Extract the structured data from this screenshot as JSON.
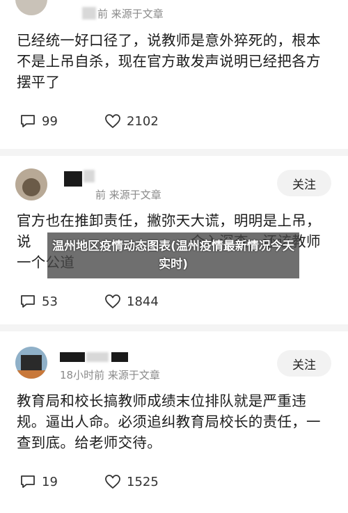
{
  "posts": [
    {
      "meta": "前  来源于文章",
      "text": "已经统一好口径了，说教师是意外猝死的，根本不是上吊自杀，现在官方敢发声说明已经把各方摆平了",
      "comments": "99",
      "likes": "2102"
    },
    {
      "meta": "前  来源于文章",
      "follow": "关注",
      "text": "官方也在推卸责任，撇弥天大谎，明明是上吊，说　　　　　　　　　　　介入深查，还该教师一个公道",
      "comments": "53",
      "likes": "1844"
    },
    {
      "meta": "18小时前  来源于文章",
      "follow": "关注",
      "text": "教育局和校长搞教师成绩末位排队就是严重违规。逼出人命。必须追纠教育局校长的责任，一查到底。给老师交待。",
      "comments": "19",
      "likes": "1525"
    }
  ],
  "banner": "温州地区疫情动态图表(温州疫情最新情况今天实时)",
  "icons": {
    "comment": "comment-bubble-icon",
    "like": "heart-icon"
  },
  "colors": {
    "text": "#1c1c1c",
    "meta": "#8a8a8a",
    "follow_bg": "#f2f2f2",
    "banner_bg": "#464646"
  }
}
